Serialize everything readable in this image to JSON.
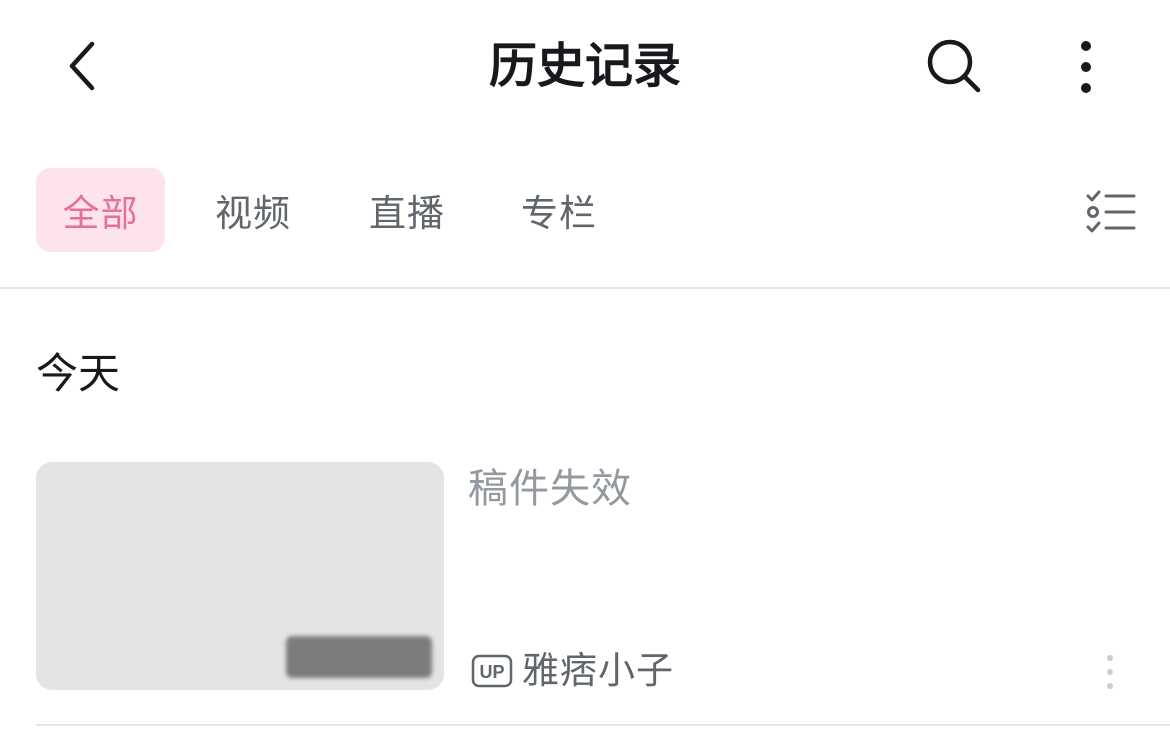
{
  "header": {
    "title": "历史记录",
    "back_icon": "chevron-left-icon",
    "search_icon": "search-icon",
    "more_icon": "more-vertical-icon"
  },
  "tabs": [
    {
      "label": "全部",
      "active": true
    },
    {
      "label": "视频",
      "active": false
    },
    {
      "label": "直播",
      "active": false
    },
    {
      "label": "专栏",
      "active": false
    }
  ],
  "edit_icon": "checklist-icon",
  "section": {
    "title": "今天"
  },
  "items": [
    {
      "title": "稿件失效",
      "duration": "",
      "up_badge": "UP",
      "uploader": "雅痞小子",
      "more_icon": "more-vertical-icon"
    }
  ],
  "colors": {
    "accent": "#e86f96",
    "accent_bg": "#fde4ec",
    "text_primary": "#18191c",
    "text_secondary": "#61666d",
    "text_muted": "#9499a0",
    "divider": "#e3e5e7",
    "thumb_bg": "#e3e4e5"
  }
}
